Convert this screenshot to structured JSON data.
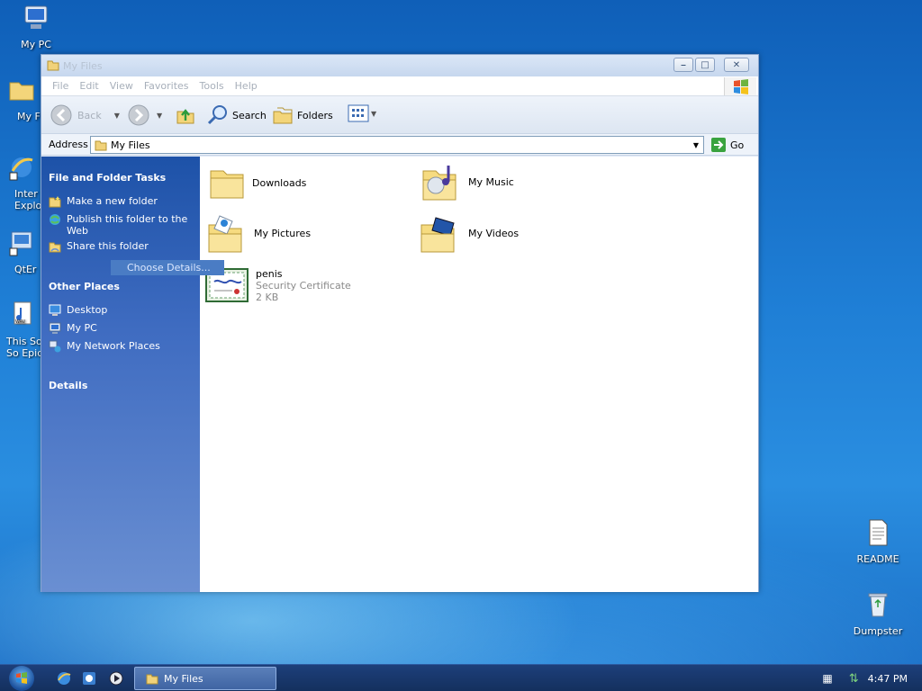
{
  "desktop": {
    "icons_left": [
      {
        "label": "My PC",
        "icon": "computer-icon"
      },
      {
        "label": "My F",
        "icon": "folder-icon"
      },
      {
        "label": "Inter",
        "label2": "Explo",
        "icon": "internet-explorer-icon"
      },
      {
        "label": "QtEr",
        "icon": "qt-app-icon"
      },
      {
        "label": "This So",
        "label2": "So Epic",
        "icon": "audio-file-icon"
      }
    ],
    "icons_right": [
      {
        "label": "README",
        "icon": "text-file-icon"
      },
      {
        "label": "Dumpster",
        "icon": "recycle-bin-icon"
      }
    ]
  },
  "window": {
    "title": "My Files",
    "menu": [
      "File",
      "Edit",
      "View",
      "Favorites",
      "Tools",
      "Help"
    ],
    "toolbar": {
      "back_label": "Back",
      "search_label": "Search",
      "folders_label": "Folders"
    },
    "address": {
      "label": "Address",
      "value": "My Files",
      "go_label": "Go"
    },
    "left_pane": {
      "tasks_heading": "File and Folder Tasks",
      "tasks": [
        {
          "label": "Make a new folder",
          "icon": "new-folder-icon"
        },
        {
          "label": "Publish this folder to the",
          "label2": "Web",
          "icon": "publish-web-icon"
        },
        {
          "label": "Share this folder",
          "icon": "share-folder-icon"
        }
      ],
      "tooltip": "Choose Details...",
      "places_heading": "Other Places",
      "places": [
        {
          "label": "Desktop",
          "icon": "desktop-icon"
        },
        {
          "label": "My PC",
          "icon": "computer-icon"
        },
        {
          "label": "My Network Places",
          "icon": "network-icon"
        }
      ],
      "details_heading": "Details"
    },
    "items": [
      {
        "name": "Downloads",
        "icon": "folder-icon"
      },
      {
        "name": "My Music",
        "icon": "music-folder-icon"
      },
      {
        "name": "My Pictures",
        "icon": "pictures-folder-icon"
      },
      {
        "name": "My Videos",
        "icon": "videos-folder-icon"
      },
      {
        "name": "penis",
        "type": "Security Certificate",
        "size": "2 KB",
        "icon": "certificate-icon"
      }
    ]
  },
  "taskbar": {
    "active_window": "My Files",
    "clock": "4:47 PM"
  },
  "colors": {
    "desktop_blue": "#1f7fd6",
    "left_pane_blue": "#1d52a8",
    "taskbar": "#14305e"
  }
}
